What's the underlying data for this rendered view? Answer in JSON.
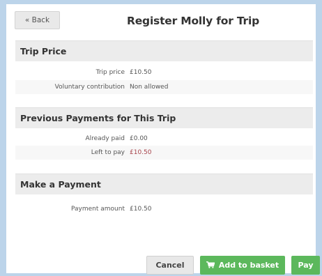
{
  "header": {
    "back_label": "« Back",
    "title": "Register Molly for Trip"
  },
  "trip_price": {
    "heading": "Trip Price",
    "rows": [
      {
        "label": "Trip price",
        "value": "£10.50"
      },
      {
        "label": "Voluntary contribution",
        "value": "Non allowed"
      }
    ]
  },
  "previous_payments": {
    "heading": "Previous Payments for This Trip",
    "rows": [
      {
        "label": "Already paid",
        "value": "£0.00"
      },
      {
        "label": "Left to pay",
        "value": "£10.50"
      }
    ]
  },
  "make_payment": {
    "heading": "Make a Payment",
    "rows": [
      {
        "label": "Payment amount",
        "value": "£10.50"
      }
    ]
  },
  "footer": {
    "cancel_label": "Cancel",
    "basket_label": "Add to basket",
    "basket_icon": "shopping-cart-icon",
    "pay_label": "Pay"
  },
  "colors": {
    "accent_green": "#5cb85c",
    "amount_due_red": "#a7434a",
    "page_background": "#bcd4ea"
  }
}
